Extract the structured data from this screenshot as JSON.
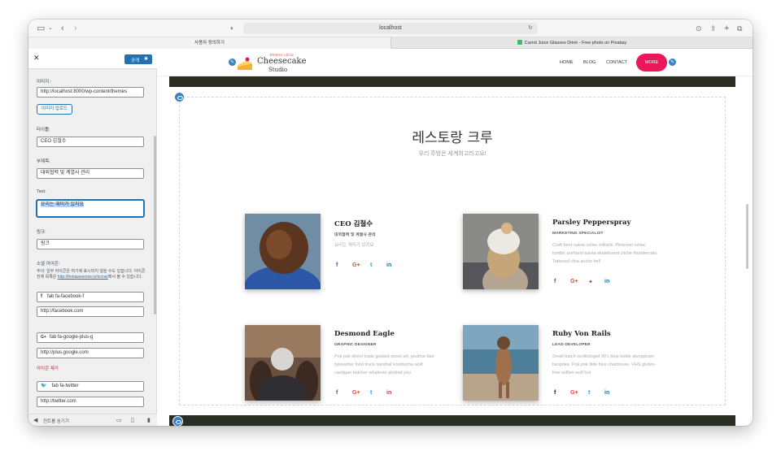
{
  "browser": {
    "url": "localhost",
    "tabs": [
      {
        "label": "사용자 정의하기"
      },
      {
        "label": "Carrot Juice Glasses Drink - Free photo on Pixabay"
      }
    ]
  },
  "panel": {
    "publish_label": "공개",
    "fields": [
      {
        "label": "이미지 :",
        "value": "http://localhost:8000/wp-content/themes"
      },
      {
        "upload_label": "이미지 업로드"
      },
      {
        "label": "타이틀:",
        "value": "CEO 김철수"
      },
      {
        "label": "부제목:",
        "value": "대외협력 및 계열사 관리"
      },
      {
        "label": "Text:",
        "value": "요리는 재미가 있지요"
      },
      {
        "label": "링크:",
        "value": "링크"
      }
    ],
    "social_label": "소셜 아이콘:",
    "social_note_1": "주의: 일부 아이콘은 여기에 표시되지 않을 수도 있습니다. 아이콘 전체 목록은 ",
    "social_note_link": "http://fontawesome.io/icons/",
    "social_note_2": "에서 볼 수 있습니다.",
    "socials": [
      {
        "icon": "fab fa-facebook-f",
        "glyph": "f",
        "url": "http://facebook.com"
      },
      {
        "icon": "fab fa-google-plus-g",
        "glyph": "G+",
        "url": "http://plus.google.com",
        "remove": "아이콘 제거"
      },
      {
        "icon": "fab fa-twitter",
        "glyph": "🐦",
        "url": "http://twitter.com"
      }
    ],
    "hide_controls": "컨트롤 숨기기"
  },
  "site": {
    "logo_small": "치즈케이크 스튜디오",
    "logo_name": "Cheesecake",
    "logo_sub": "Studio",
    "nav": [
      "HOME",
      "BLOG",
      "CONTACT"
    ],
    "more": "MORE"
  },
  "section": {
    "title": "레스토랑 크루",
    "subtitle": "우리 주방은 세계최고라고요!"
  },
  "members": [
    {
      "name": "CEO 김철수",
      "role": "대외협력 및 계열사 관리",
      "desc": "요리는 재미가 있지요"
    },
    {
      "name": "Parsley Pepperspray",
      "role": "MARKETING SPECIALIST",
      "desc": "Craft beer salvia celiac mlkshk. Pinterest celiac tumblr, portland salvia skateboard cliche thundercats. Tattooed chia austin hell"
    },
    {
      "name": "Desmond Eagle",
      "role": "GRAPHIC DESIGNER",
      "desc": "Pok pok direct trade godard street art, poutine fam typewriter food truck narwhal kombucha wolf cardigan butcher whatever pickled you"
    },
    {
      "name": "Ruby Von Rails",
      "role": "LEAD DEVELOPER",
      "desc": "Small batch vexillologist 90's blue bottle stumptown bespoke. Pok pok tilde fixie chartreuse, VHS gluten-free selfies wolf hot"
    }
  ],
  "social_glyphs": {
    "facebook": "f",
    "google": "G+",
    "twitter": "t",
    "linkedin": "in"
  },
  "colors": {
    "accent": "#e8185b",
    "wp_blue": "#2271b1",
    "edit_blue": "#3582c4"
  }
}
